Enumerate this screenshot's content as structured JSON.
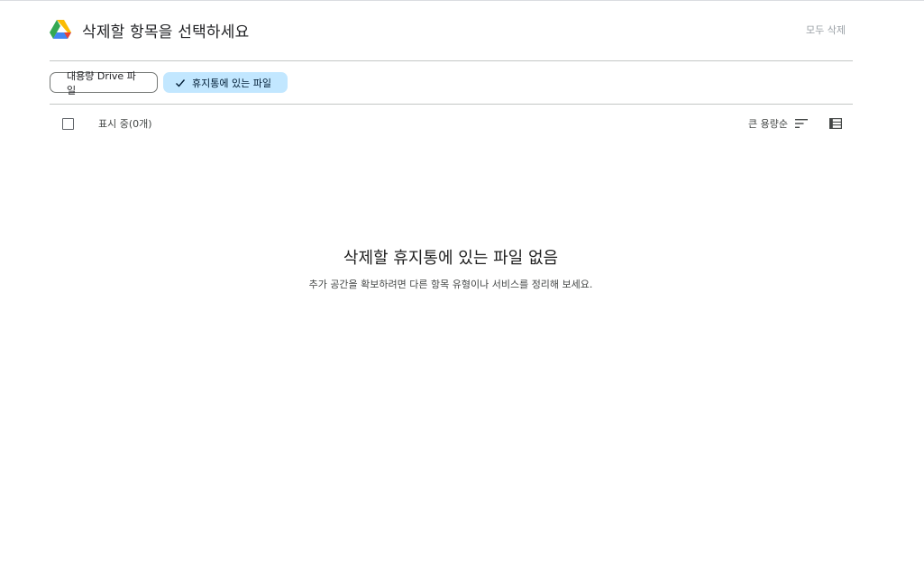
{
  "header": {
    "title": "삭제할 항목을 선택하세요",
    "delete_all_label": "모두 삭제",
    "logo_icon": "google-drive-icon"
  },
  "filters": {
    "chips": [
      {
        "label": "대용량 Drive 파일",
        "selected": false
      },
      {
        "label": "휴지통에 있는 파일",
        "selected": true,
        "icon": "check-icon"
      }
    ]
  },
  "toolbar": {
    "showing_label": "표시 중(0개)",
    "sort_label": "큰 용량순",
    "sort_icon": "sort-icon",
    "view_icon": "list-view-icon"
  },
  "empty_state": {
    "title": "삭제할 휴지통에 있는 파일 없음",
    "subtitle": "추가 공간을 확보하려면 다른 항목 유형이나 서비스를 정리해 보세요."
  },
  "colors": {
    "selected_chip_bg": "#c2e7ff",
    "divider": "#c4c7c5",
    "muted_text": "#9aa0a6"
  }
}
